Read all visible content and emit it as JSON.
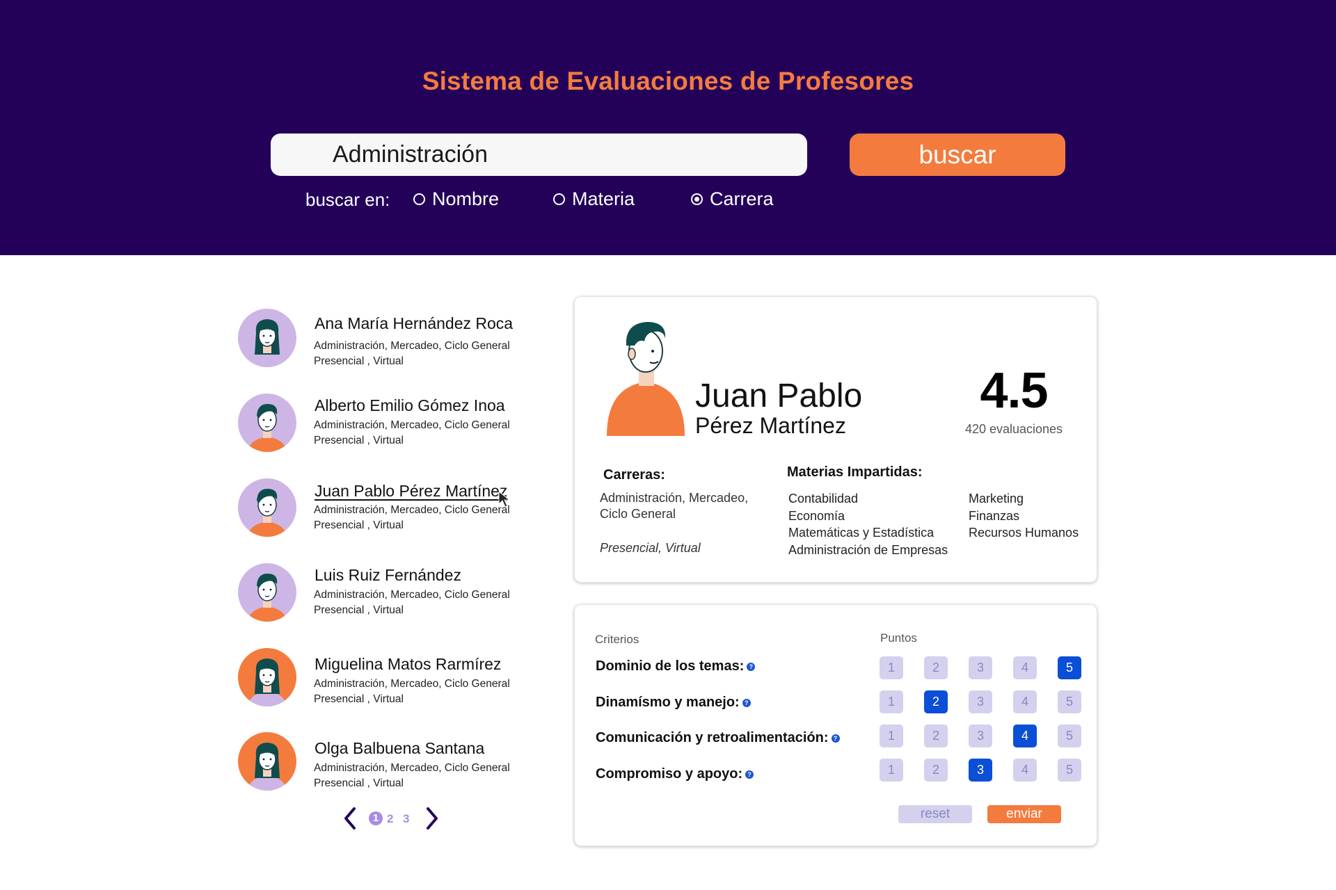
{
  "header": {
    "title": "Sistema de Evaluaciones de Profesores",
    "search_value": "Administración",
    "search_button": "buscar",
    "search_in_label": "buscar en:",
    "options": [
      {
        "label": "Nombre",
        "checked": false
      },
      {
        "label": "Materia",
        "checked": false
      },
      {
        "label": "Carrera",
        "checked": true
      }
    ]
  },
  "teachers": [
    {
      "name": "Ana María Hernández Roca",
      "careers": "Administración, Mercadeo, Ciclo General",
      "modality": "Presencial , Virtual",
      "avatar": "woman-avatar-icon",
      "bg": "#cdb6e6"
    },
    {
      "name": "Alberto Emilio Gómez Inoa",
      "careers": "Administración, Mercadeo, Ciclo General",
      "modality": "Presencial , Virtual",
      "avatar": "man-avatar-icon",
      "bg": "#cdb6e6"
    },
    {
      "name": "Juan Pablo Pérez Martínez",
      "careers": "Administración, Mercadeo, Ciclo General",
      "modality": "Presencial , Virtual",
      "avatar": "man-avatar-icon",
      "bg": "#cdb6e6"
    },
    {
      "name": "Luis Ruiz Fernández",
      "careers": "Administración, Mercadeo, Ciclo General",
      "modality": "Presencial , Virtual",
      "avatar": "man-avatar-icon",
      "bg": "#cdb6e6"
    },
    {
      "name": "Miguelina Matos Rarmírez",
      "careers": "Administración, Mercadeo, Ciclo General",
      "modality": "Presencial , Virtual",
      "avatar": "woman-avatar-icon",
      "bg": "#f47b3e"
    },
    {
      "name": "Olga Balbuena Santana",
      "careers": "Administración, Mercadeo, Ciclo General",
      "modality": "Presencial , Virtual",
      "avatar": "woman-avatar-icon",
      "bg": "#f47b3e"
    }
  ],
  "pagination": {
    "pages": [
      "1",
      "2",
      "3"
    ],
    "current": "1"
  },
  "profile": {
    "first_name": "Juan Pablo",
    "last_name": "Pérez Martínez",
    "rating": "4.5",
    "evaluations": "420 evaluaciones",
    "careers_label": "Carreras:",
    "careers_line1": "Administración, Mercadeo,",
    "careers_line2": "Ciclo General",
    "modality": "Presencial, Virtual",
    "subjects_label": "Materias Impartidas:",
    "subjects_col1": [
      "Contabilidad",
      "Economía",
      "Matemáticas y Estadística",
      "Administración de Empresas"
    ],
    "subjects_col2": [
      "Marketing",
      "Finanzas",
      "Recursos Humanos"
    ]
  },
  "evaluation": {
    "criteria_header": "Criterios",
    "points_header": "Puntos",
    "criteria": [
      {
        "label": "Dominio de los temas:",
        "selected": 5
      },
      {
        "label": "Dinamísmo y manejo:",
        "selected": 2
      },
      {
        "label": "Comunicación y retroalimentación:",
        "selected": 4
      },
      {
        "label": "Compromiso y apoyo:",
        "selected": 3
      }
    ],
    "scores": [
      "1",
      "2",
      "3",
      "4",
      "5"
    ],
    "reset_label": "reset",
    "send_label": "enviar"
  },
  "colors": {
    "header_bg": "#230159",
    "accent": "#f47b3e",
    "selected": "#0b4fd6",
    "unselected": "#d3d1ee"
  }
}
